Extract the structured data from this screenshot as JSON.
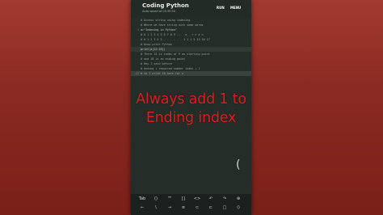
{
  "app": {
    "title": "Coding Python",
    "subtitle": "Auto saved at 05:39:52",
    "run_label": "RUN",
    "menu_label": "MENU"
  },
  "editor": {
    "lines": [
      {
        "num": "",
        "text": "# Access string using indexing"
      },
      {
        "num": "",
        "text": "# Where we have string with some words"
      },
      {
        "num": "1",
        "text": "a=\"Indexing in Python\""
      },
      {
        "num": "",
        "text": "# 0 1 2 3 4 5 6 7 8 9 ...  a _ r n e n"
      },
      {
        "num": "",
        "text": "# 0 1 2 3 4 5 . . . . . . 1 1 1 5 13 16 17"
      },
      {
        "num": "",
        "text": "# Know print Python"
      },
      {
        "num": "",
        "text": "print(a[12:18])"
      },
      {
        "num": "",
        "text": "# There 12 is index of P as starting point"
      },
      {
        "num": "",
        "text": "# and 18 is an ending point"
      },
      {
        "num": "",
        "text": "# Hey I said before"
      },
      {
        "num": "",
        "text": "# ending + required number index + 1"
      },
      {
        "num": "12",
        "text": "# so I write 18 here for n"
      }
    ]
  },
  "overlay": {
    "line1": "Always add 1 to",
    "line2": "Ending index"
  },
  "side_glyph": "(",
  "keybar": {
    "row1": [
      "Tab",
      "()",
      "\"\"",
      "[]",
      "<>",
      "↶",
      "↷",
      "⊕"
    ],
    "row2": [
      "←",
      "\\",
      "→",
      "≡",
      "⊂",
      "⊏",
      "□",
      "⟨⟩"
    ]
  }
}
